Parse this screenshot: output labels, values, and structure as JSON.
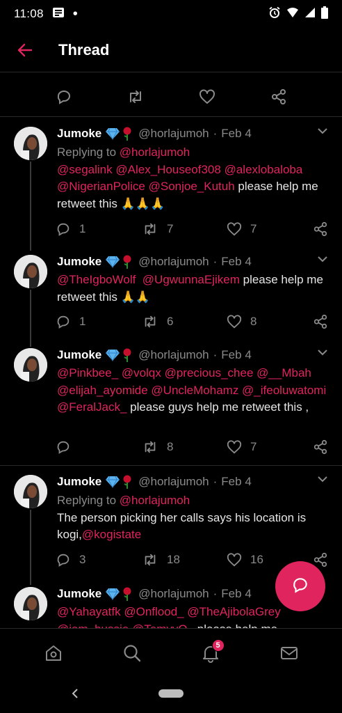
{
  "status_bar": {
    "time": "11:08",
    "dot": "•"
  },
  "header": {
    "title": "Thread"
  },
  "tweets": [
    {
      "name": "Jumoke",
      "handle": "@horlajumoh",
      "sep": "·",
      "date": "Feb 4",
      "replying_label": "Replying to ",
      "replying_handle": "@horlajumoh",
      "mentions": [
        "@segalink",
        "@Alex_Houseof308",
        "@alexlobaloba",
        "@NigerianPolice",
        "@Sonjoe_Kutuh"
      ],
      "text": " please help me retweet this",
      "emoji": "🙏🙏🙏",
      "replies": "1",
      "retweets": "7",
      "likes": "7"
    },
    {
      "name": "Jumoke",
      "handle": "@horlajumoh",
      "sep": "·",
      "date": "Feb 4",
      "mentions": [
        "@TheIgboWolf",
        "@UgwunnaEjikem"
      ],
      "text": " please help me retweet this",
      "emoji": "🙏🙏",
      "replies": "1",
      "retweets": "6",
      "likes": "8"
    },
    {
      "name": "Jumoke",
      "handle": "@horlajumoh",
      "sep": "·",
      "date": "Feb 4",
      "mentions": [
        "@Pinkbee_",
        "@volqx",
        "@precious_chee",
        "@__Mbah",
        "@elijah_ayomide",
        "@UncleMohamz",
        "@_ifeoluwatomi",
        "@FeralJack_"
      ],
      "text": " please guys help me retweet this ,",
      "replies": "",
      "retweets": "8",
      "likes": "7"
    },
    {
      "name": "Jumoke",
      "handle": "@horlajumoh",
      "sep": "·",
      "date": "Feb 4",
      "replying_label": "Replying to ",
      "replying_handle": "@horlajumoh",
      "text": "The person picking her calls says his location is kogi,",
      "mention_after": "@kogistate",
      "replies": "3",
      "retweets": "18",
      "likes": "16"
    },
    {
      "name": "Jumoke",
      "handle": "@horlajumoh",
      "sep": "·",
      "date": "Feb 4",
      "mentions": [
        "@Yahayatfk",
        "@Onflood_",
        "@TheAjibolaGrey",
        "@iam_bussie",
        "@TemyyO_"
      ],
      "text": " please help me"
    }
  ],
  "bottom_nav": {
    "notifications_count": "5"
  },
  "colors": {
    "accent": "#e0245e",
    "background": "#000000",
    "muted": "#8a8a8a",
    "divider": "#2a2a2a"
  }
}
